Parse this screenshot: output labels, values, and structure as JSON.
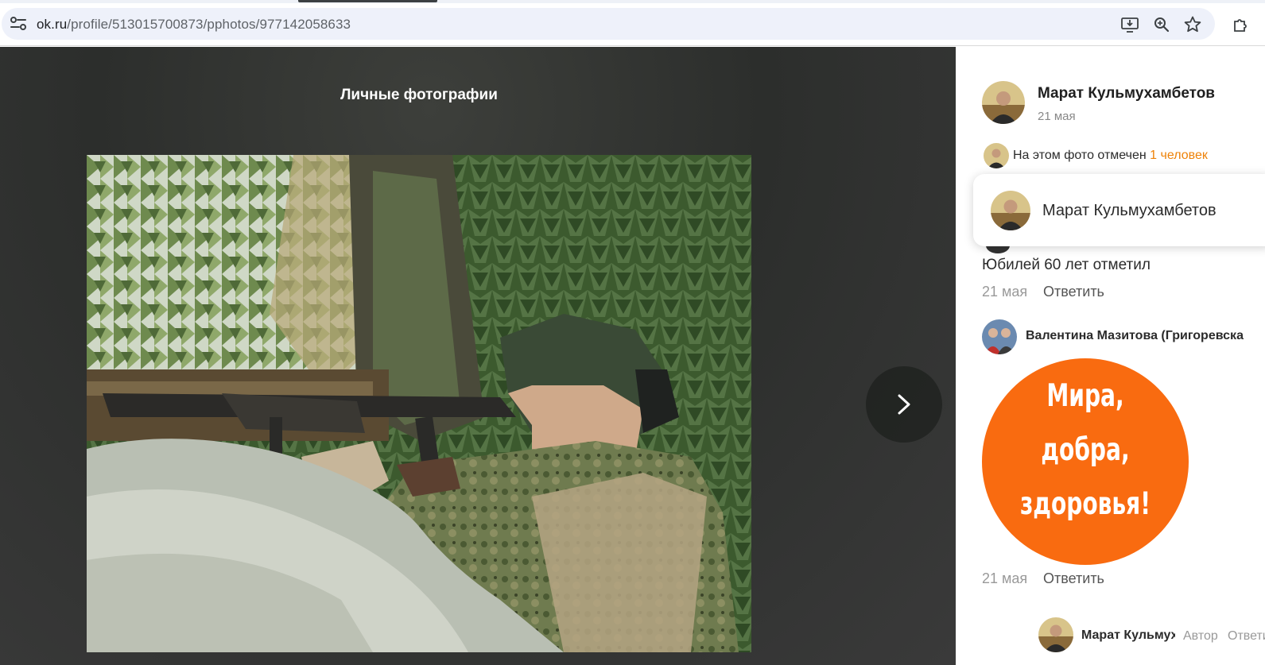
{
  "browser": {
    "url_host": "ok.ru",
    "url_path": "/profile/513015700873/pphotos/977142058633",
    "icons": [
      "site-info-icon",
      "install-app-icon",
      "zoom-icon",
      "bookmark-star-icon",
      "extensions-icon"
    ]
  },
  "viewer": {
    "album_title": "Личные фотографии",
    "next_icon": "chevron-right-icon"
  },
  "panel": {
    "author": {
      "name": "Марат Кульмухамбетов",
      "date": "21 мая"
    },
    "tagged": {
      "text": "На этом фото отмечен",
      "link": "1 человек"
    },
    "popover": {
      "name": "Марат Кульмухамбетов"
    },
    "comments": [
      {
        "text": "Юбилей 60 лет отметил",
        "date": "21 мая",
        "reply": "Ответить"
      },
      {
        "author": "Валентина Мазитова (Григоревска",
        "sticker_lines": [
          "Мира,",
          "добра,",
          "здоровья!"
        ],
        "date": "21 мая",
        "reply": "Ответить"
      },
      {
        "author": "Марат Кульмух",
        "role": "Автор",
        "reply": "Ответить"
      }
    ]
  },
  "colors": {
    "accent_orange": "#ee8208",
    "sticker_orange": "#f96b10"
  }
}
